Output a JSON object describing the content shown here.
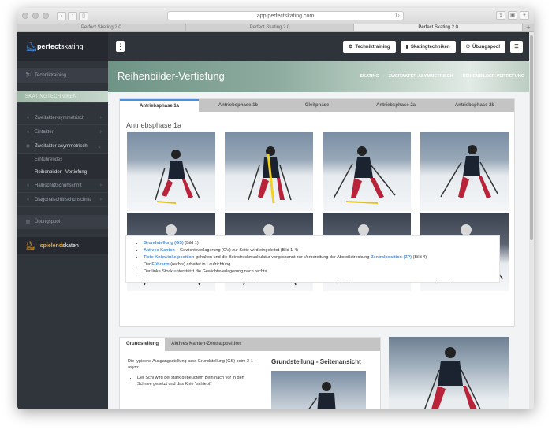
{
  "browser": {
    "url": "app.perfectskating.com",
    "tabs": [
      "Perfect Skating 2.0",
      "Perfect Skating 2.0",
      "Perfect Skating 2.0"
    ],
    "active_tab": 2
  },
  "brand": {
    "bold": "perfect",
    "light": "skating"
  },
  "sidebar": {
    "items": [
      {
        "label": "Techniktraining"
      },
      {
        "label": "SKATINGTECHNIKEN"
      },
      {
        "label": "Zweitakter-symmetrisch"
      },
      {
        "label": "Eintakter"
      },
      {
        "label": "Zweitakter-asymmetrisch"
      },
      {
        "label": "Einführendes"
      },
      {
        "label": "Reihenbilder - Vertiefung"
      },
      {
        "label": "Halbschlittschuhschritt"
      },
      {
        "label": "Diagonalschlittschuhschritt"
      },
      {
        "label": "Übungspool"
      }
    ],
    "brand2": {
      "bold": "spielend",
      "light": "skaten"
    }
  },
  "topnav": {
    "buttons": [
      "Techniktraining",
      "Skatingtechniken",
      "Übungspool"
    ]
  },
  "page": {
    "title": "Reihenbilder-Vertiefung",
    "breadcrumb": [
      "SKATING",
      "ZWEITAKTER-ASYMMETRISCH",
      "REIHENBILDER-VERTIEFUNG"
    ]
  },
  "phase_tabs": [
    "Antriebsphase 1a",
    "Antriebsphase 1b",
    "Gleitphase",
    "Antriebsphase 2a",
    "Antriebsphase 2b"
  ],
  "phase_title": "Antriebsphase 1a",
  "bullets": [
    {
      "hl": "Grundstellung (GS)",
      "text": " (Bild 1)"
    },
    {
      "hl": "Aktives Kanten",
      "text": " – Gewichtsverlagerung (GV) zur Seite wird eingeleitet (Bild 1-4)"
    },
    {
      "hl": "Tiefe Kniewinkelposition",
      "text": " gehalten und die Beinstreckmuskulatur vorgespannt zur Vorbereitung der Abstoßstreckung-",
      "hl2": "Zentralposition (ZP)",
      "text2": " (Bild 4)"
    },
    {
      "pre": "Der ",
      "hl": "Führarm",
      "text": " (rechts) arbeitet in Laufrichtung"
    },
    {
      "pre": "Der linke Stock unterstützt die Gewichtsverlagerung nach rechts"
    }
  ],
  "panel2": {
    "tabs": [
      "Grundstellung",
      "Aktives Kanten-Zentralposition"
    ],
    "intro": "Die typische Ausgangsstellung bzw. Grundstellung (GS) beim 2-1-asym:",
    "list": [
      "Der Schi wird bei stark gebeugtem Bein nach vor in den Schnee gesetzt und das Knie \"schiebt\""
    ],
    "heading": "Grundstellung - Seitenansicht"
  },
  "colors": {
    "accent": "#4a90e2",
    "sidebar": "#30353c",
    "topnav": "#2f343b"
  }
}
